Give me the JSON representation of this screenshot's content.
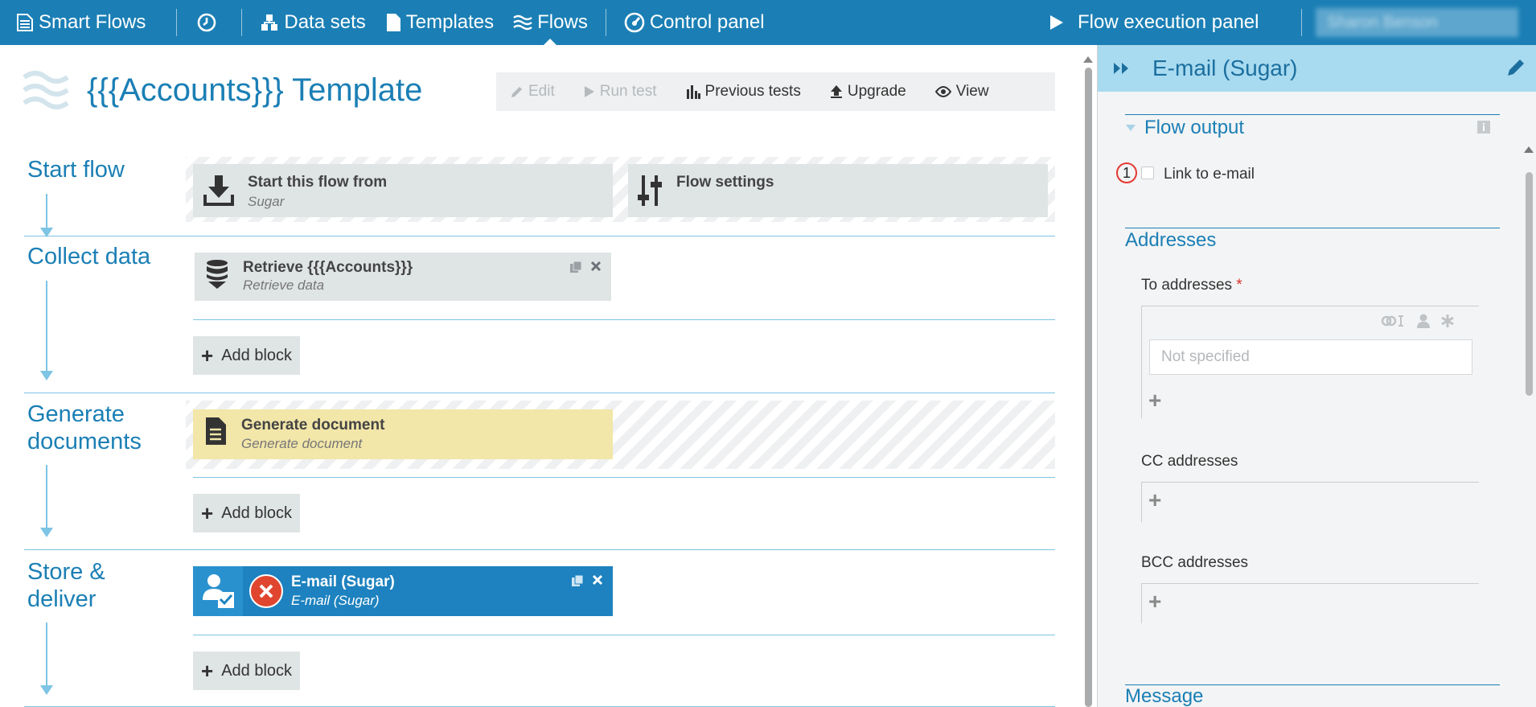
{
  "nav": {
    "brand": "Smart Flows",
    "history_icon": "clock-icon",
    "items": [
      {
        "label": "Data sets"
      },
      {
        "label": "Templates"
      },
      {
        "label": "Flows"
      },
      {
        "label": "Control panel"
      }
    ],
    "execution_panel": "Flow execution panel",
    "user": "Sharon Benson"
  },
  "page": {
    "title": "{{{Accounts}}} Template"
  },
  "toolbar": {
    "edit": "Edit",
    "run_test": "Run test",
    "previous_tests": "Previous tests",
    "upgrade": "Upgrade",
    "view": "View"
  },
  "stages": [
    {
      "label": "Start flow"
    },
    {
      "label": "Collect data"
    },
    {
      "label_line1": "Generate",
      "label_line2": "documents"
    },
    {
      "label_line1": "Store &",
      "label_line2": "deliver"
    }
  ],
  "blocks": {
    "start_from": {
      "title": "Start this flow from",
      "sub": "Sugar"
    },
    "flow_settings": {
      "title": "Flow settings"
    },
    "retrieve": {
      "title": "Retrieve {{{Accounts}}}",
      "sub": "Retrieve data"
    },
    "generate": {
      "title": "Generate document",
      "sub": "Generate document"
    },
    "email": {
      "title": "E-mail (Sugar)",
      "sub": "E-mail (Sugar)"
    }
  },
  "add_block_label": "Add block",
  "side": {
    "title": "E-mail (Sugar)",
    "flow_output": {
      "title": "Flow output",
      "link_label": "Link to e-mail",
      "marker": "1"
    },
    "addresses": {
      "title": "Addresses",
      "to_label": "To addresses",
      "required_mark": "*",
      "to_placeholder": "Not specified",
      "cc_label": "CC addresses",
      "bcc_label": "BCC addresses"
    },
    "message": {
      "title": "Message"
    }
  },
  "colors": {
    "primary": "#1b7fb5",
    "header_panel": "#a8daf0",
    "block_gray": "#dfe4e5",
    "block_yellow": "#f2e6a9",
    "block_blue": "#1d82bf",
    "error_red": "#e0452f"
  }
}
